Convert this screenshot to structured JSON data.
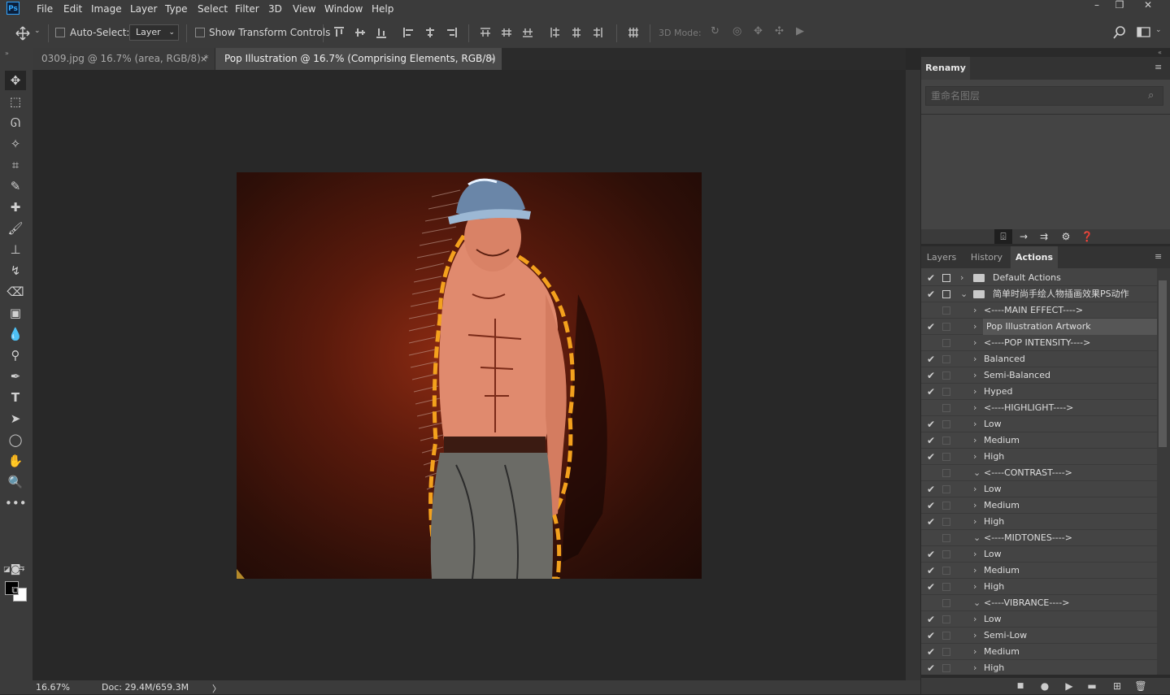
{
  "menubar": {
    "logo": "Ps",
    "items": [
      "File",
      "Edit",
      "Image",
      "Layer",
      "Type",
      "Select",
      "Filter",
      "3D",
      "View",
      "Window",
      "Help"
    ],
    "window_controls": [
      "–",
      "❐",
      "✕"
    ]
  },
  "options": {
    "move_icon": "move-icon",
    "auto_select_label": "Auto-Select:",
    "auto_select_target": "Layer",
    "show_transform_label": "Show Transform Controls",
    "mode_3d_label": "3D Mode:"
  },
  "tabs": [
    {
      "label": "0309.jpg @ 16.7% (area, RGB/8) *",
      "close": "×"
    },
    {
      "label": "Pop Illustration @ 16.7% (Comprising Elements, RGB/8) *",
      "close": "×"
    }
  ],
  "status": {
    "zoom": "16.67%",
    "doc": "Doc: 29.4M/659.3M",
    "arrow": "〉"
  },
  "renamy": {
    "tab": "Renamy",
    "placeholder": "重命名图层",
    "search_icon": "⌕"
  },
  "panel_tabs": [
    "Layers",
    "History",
    "Actions"
  ],
  "actions": [
    {
      "check": "✔",
      "label": "Default Actions",
      "type": "set",
      "expanded": false
    },
    {
      "check": "✔",
      "label": "简单时尚手绘人物插画效果PS动作",
      "type": "set",
      "expanded": true
    },
    {
      "check": "",
      "label": "<----MAIN EFFECT---->",
      "type": "action",
      "expanded": false
    },
    {
      "check": "✔",
      "label": "Pop Illustration Artwork",
      "type": "action",
      "expanded": false,
      "selected": true
    },
    {
      "check": "",
      "label": "<----POP INTENSITY---->",
      "type": "action",
      "expanded": false
    },
    {
      "check": "✔",
      "label": "Balanced",
      "type": "action",
      "expanded": false
    },
    {
      "check": "✔",
      "label": "Semi-Balanced",
      "type": "action",
      "expanded": false
    },
    {
      "check": "✔",
      "label": "Hyped",
      "type": "action",
      "expanded": false
    },
    {
      "check": "",
      "label": "<----HIGHLIGHT---->",
      "type": "action",
      "expanded": false
    },
    {
      "check": "✔",
      "label": "Low",
      "type": "action",
      "expanded": false
    },
    {
      "check": "✔",
      "label": "Medium",
      "type": "action",
      "expanded": false
    },
    {
      "check": "✔",
      "label": "High",
      "type": "action",
      "expanded": false
    },
    {
      "check": "",
      "label": "<----CONTRAST---->",
      "type": "action",
      "expanded": true
    },
    {
      "check": "✔",
      "label": "Low",
      "type": "action",
      "expanded": false
    },
    {
      "check": "✔",
      "label": "Medium",
      "type": "action",
      "expanded": false
    },
    {
      "check": "✔",
      "label": "High",
      "type": "action",
      "expanded": false
    },
    {
      "check": "",
      "label": "<----MIDTONES---->",
      "type": "action",
      "expanded": true
    },
    {
      "check": "✔",
      "label": "Low",
      "type": "action",
      "expanded": false
    },
    {
      "check": "✔",
      "label": "Medium",
      "type": "action",
      "expanded": false
    },
    {
      "check": "✔",
      "label": "High",
      "type": "action",
      "expanded": false
    },
    {
      "check": "",
      "label": "<----VIBRANCE---->",
      "type": "action",
      "expanded": true
    },
    {
      "check": "✔",
      "label": "Low",
      "type": "action",
      "expanded": false
    },
    {
      "check": "✔",
      "label": "Semi-Low",
      "type": "action",
      "expanded": false
    },
    {
      "check": "✔",
      "label": "Medium",
      "type": "action",
      "expanded": false
    },
    {
      "check": "✔",
      "label": "High",
      "type": "action",
      "expanded": false
    }
  ],
  "colors": {
    "foreground": "#000000",
    "background": "#ffffff",
    "accent_ps": "#31a8ff"
  }
}
